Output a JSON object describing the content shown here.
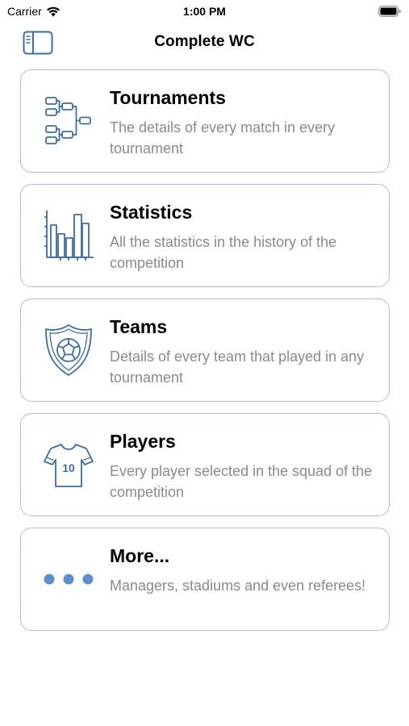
{
  "status_bar": {
    "carrier": "Carrier",
    "time": "1:00 PM"
  },
  "nav": {
    "title": "Complete WC"
  },
  "colors": {
    "accent": "#3b6ea8",
    "card_border": "#a9bedf",
    "dots": "#5b8fcf",
    "desc_text": "#8a8a8e"
  },
  "cards": [
    {
      "title": "Tournaments",
      "desc": "The details of every match in every tournament",
      "icon": "bracket-icon"
    },
    {
      "title": "Statistics",
      "desc": "All the statistics in the history of the competition",
      "icon": "bar-chart-icon"
    },
    {
      "title": "Teams",
      "desc": "Details of every team that played in any tournament",
      "icon": "shield-icon"
    },
    {
      "title": "Players",
      "desc": "Every player selected in the squad of the competition",
      "icon": "jersey-icon",
      "jersey_number": "10"
    },
    {
      "title": "More...",
      "desc": "Managers, stadiums and even referees!",
      "icon": "more-dots-icon"
    }
  ]
}
